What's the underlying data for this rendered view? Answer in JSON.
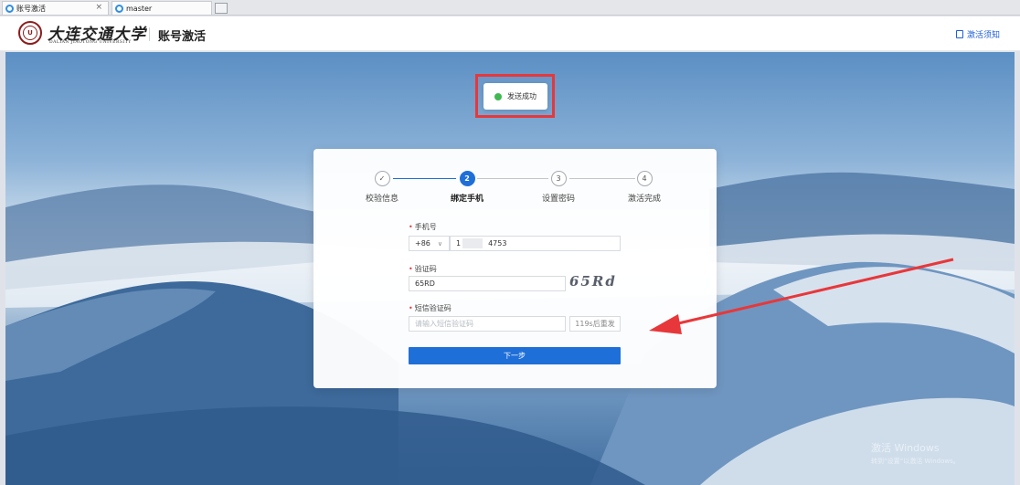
{
  "browser": {
    "tabs": [
      {
        "label": "账号激活"
      },
      {
        "label": "master"
      }
    ]
  },
  "header": {
    "logo_cn": "大连交通大学",
    "logo_en": "DALIAN JIAOTONG UNIVERSITY",
    "title": "账号激活",
    "notice_link": "激活须知"
  },
  "toast": {
    "message": "发送成功"
  },
  "steps": [
    {
      "index": "✓",
      "label": "校验信息",
      "state": "done"
    },
    {
      "index": "2",
      "label": "绑定手机",
      "state": "active"
    },
    {
      "index": "3",
      "label": "设置密码",
      "state": "pending"
    },
    {
      "index": "4",
      "label": "激活完成",
      "state": "pending"
    }
  ],
  "form": {
    "phone": {
      "label": "手机号",
      "country_code": "+86",
      "value_prefix": "1",
      "value_suffix": "4753"
    },
    "captcha": {
      "label": "验证码",
      "value": "65RD",
      "image_text": "65Rd"
    },
    "sms": {
      "label": "短信验证码",
      "placeholder": "请输入短信验证码",
      "resend_label": "119s后重发"
    },
    "next_button": "下一步"
  },
  "watermark": {
    "line1": "激活 Windows",
    "line2": "转到“设置”以激活 Windows。"
  },
  "colors": {
    "primary": "#1f6fd8",
    "annotation_red": "#e8373a",
    "success": "#3fb950"
  }
}
